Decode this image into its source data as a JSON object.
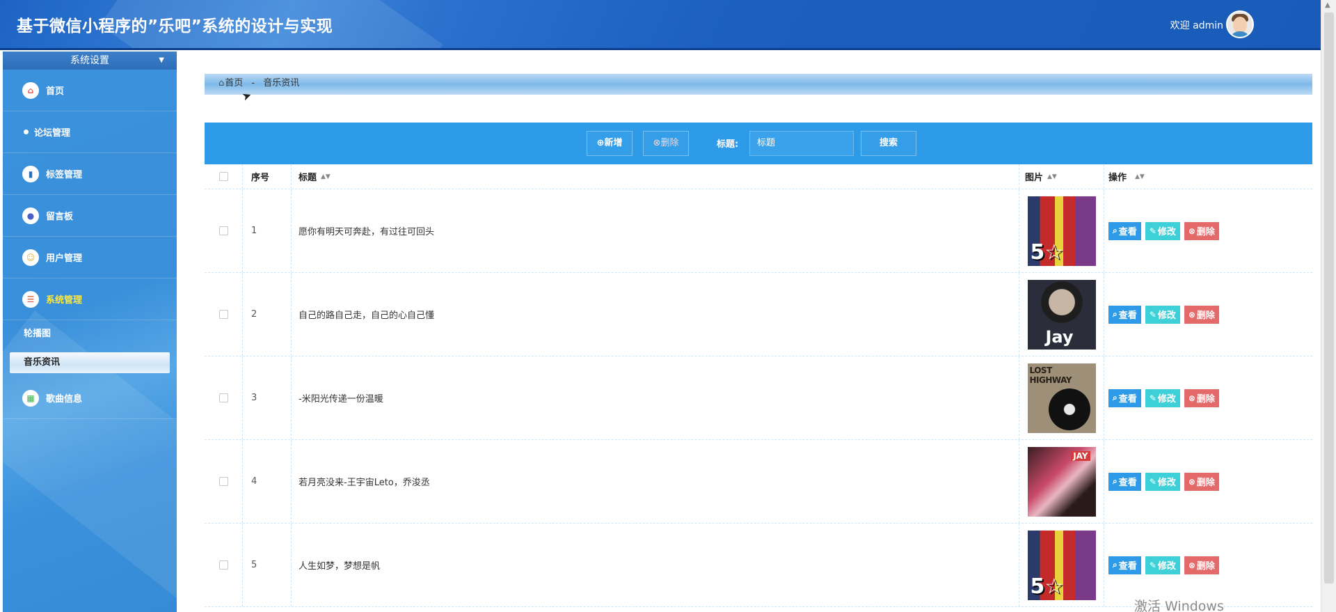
{
  "header": {
    "title": "基于微信小程序的”乐吧”系统的设计与实现",
    "welcome": "欢迎 admin"
  },
  "sidebar": {
    "section_title": "系统设置",
    "items": [
      {
        "label": "首页",
        "icon": "home-icon",
        "color": "#e8594a"
      },
      {
        "label": "论坛管理",
        "icon": "dot-icon"
      },
      {
        "label": "标签管理",
        "icon": "tag-icon",
        "color": "#2e6eb9"
      },
      {
        "label": "留言板",
        "icon": "message-icon",
        "color": "#4a5fc8"
      },
      {
        "label": "用户管理",
        "icon": "user-icon",
        "color": "#e8b23a"
      },
      {
        "label": "系统管理",
        "icon": "system-icon",
        "color": "#d9533a"
      }
    ],
    "submenu": [
      {
        "label": "轮播图"
      },
      {
        "label": "音乐资讯"
      }
    ],
    "after": {
      "label": "歌曲信息",
      "icon": "song-icon",
      "color": "#3bb24a"
    }
  },
  "breadcrumb": {
    "home": "首页",
    "separator": "-",
    "current": "音乐资讯"
  },
  "toolbar": {
    "add_label": "新增",
    "delete_label": "删除",
    "title_label": "标题:",
    "title_placeholder": "标题",
    "search_label": "搜索"
  },
  "table": {
    "columns": [
      "序号",
      "标题",
      "图片",
      "操作"
    ],
    "rows": [
      {
        "no": "1",
        "title": "愿你有明天可奔赴，有过往可回头",
        "art": "art-a"
      },
      {
        "no": "2",
        "title": "自己的路自己走，自己的心自己懂",
        "art": "art-b"
      },
      {
        "no": "3",
        "title": "-米阳光传递一份温暖",
        "art": "art-c"
      },
      {
        "no": "4",
        "title": "若月亮没来-王宇宙Leto，乔浚丞",
        "art": "art-d"
      },
      {
        "no": "5",
        "title": "人生如梦，梦想是帆",
        "art": "art-a"
      }
    ],
    "actions": {
      "view": "查看",
      "edit": "修改",
      "delete": "删除"
    }
  },
  "watermark": "激活 Windows",
  "colors": {
    "header": "#1d63c4",
    "sidebar": "#3b92dc",
    "toolbar": "#2d9be8",
    "view": "#2d9be8",
    "edit": "#3ed0d8",
    "delete": "#e46a6a",
    "active_menu": "#ffe93a"
  }
}
